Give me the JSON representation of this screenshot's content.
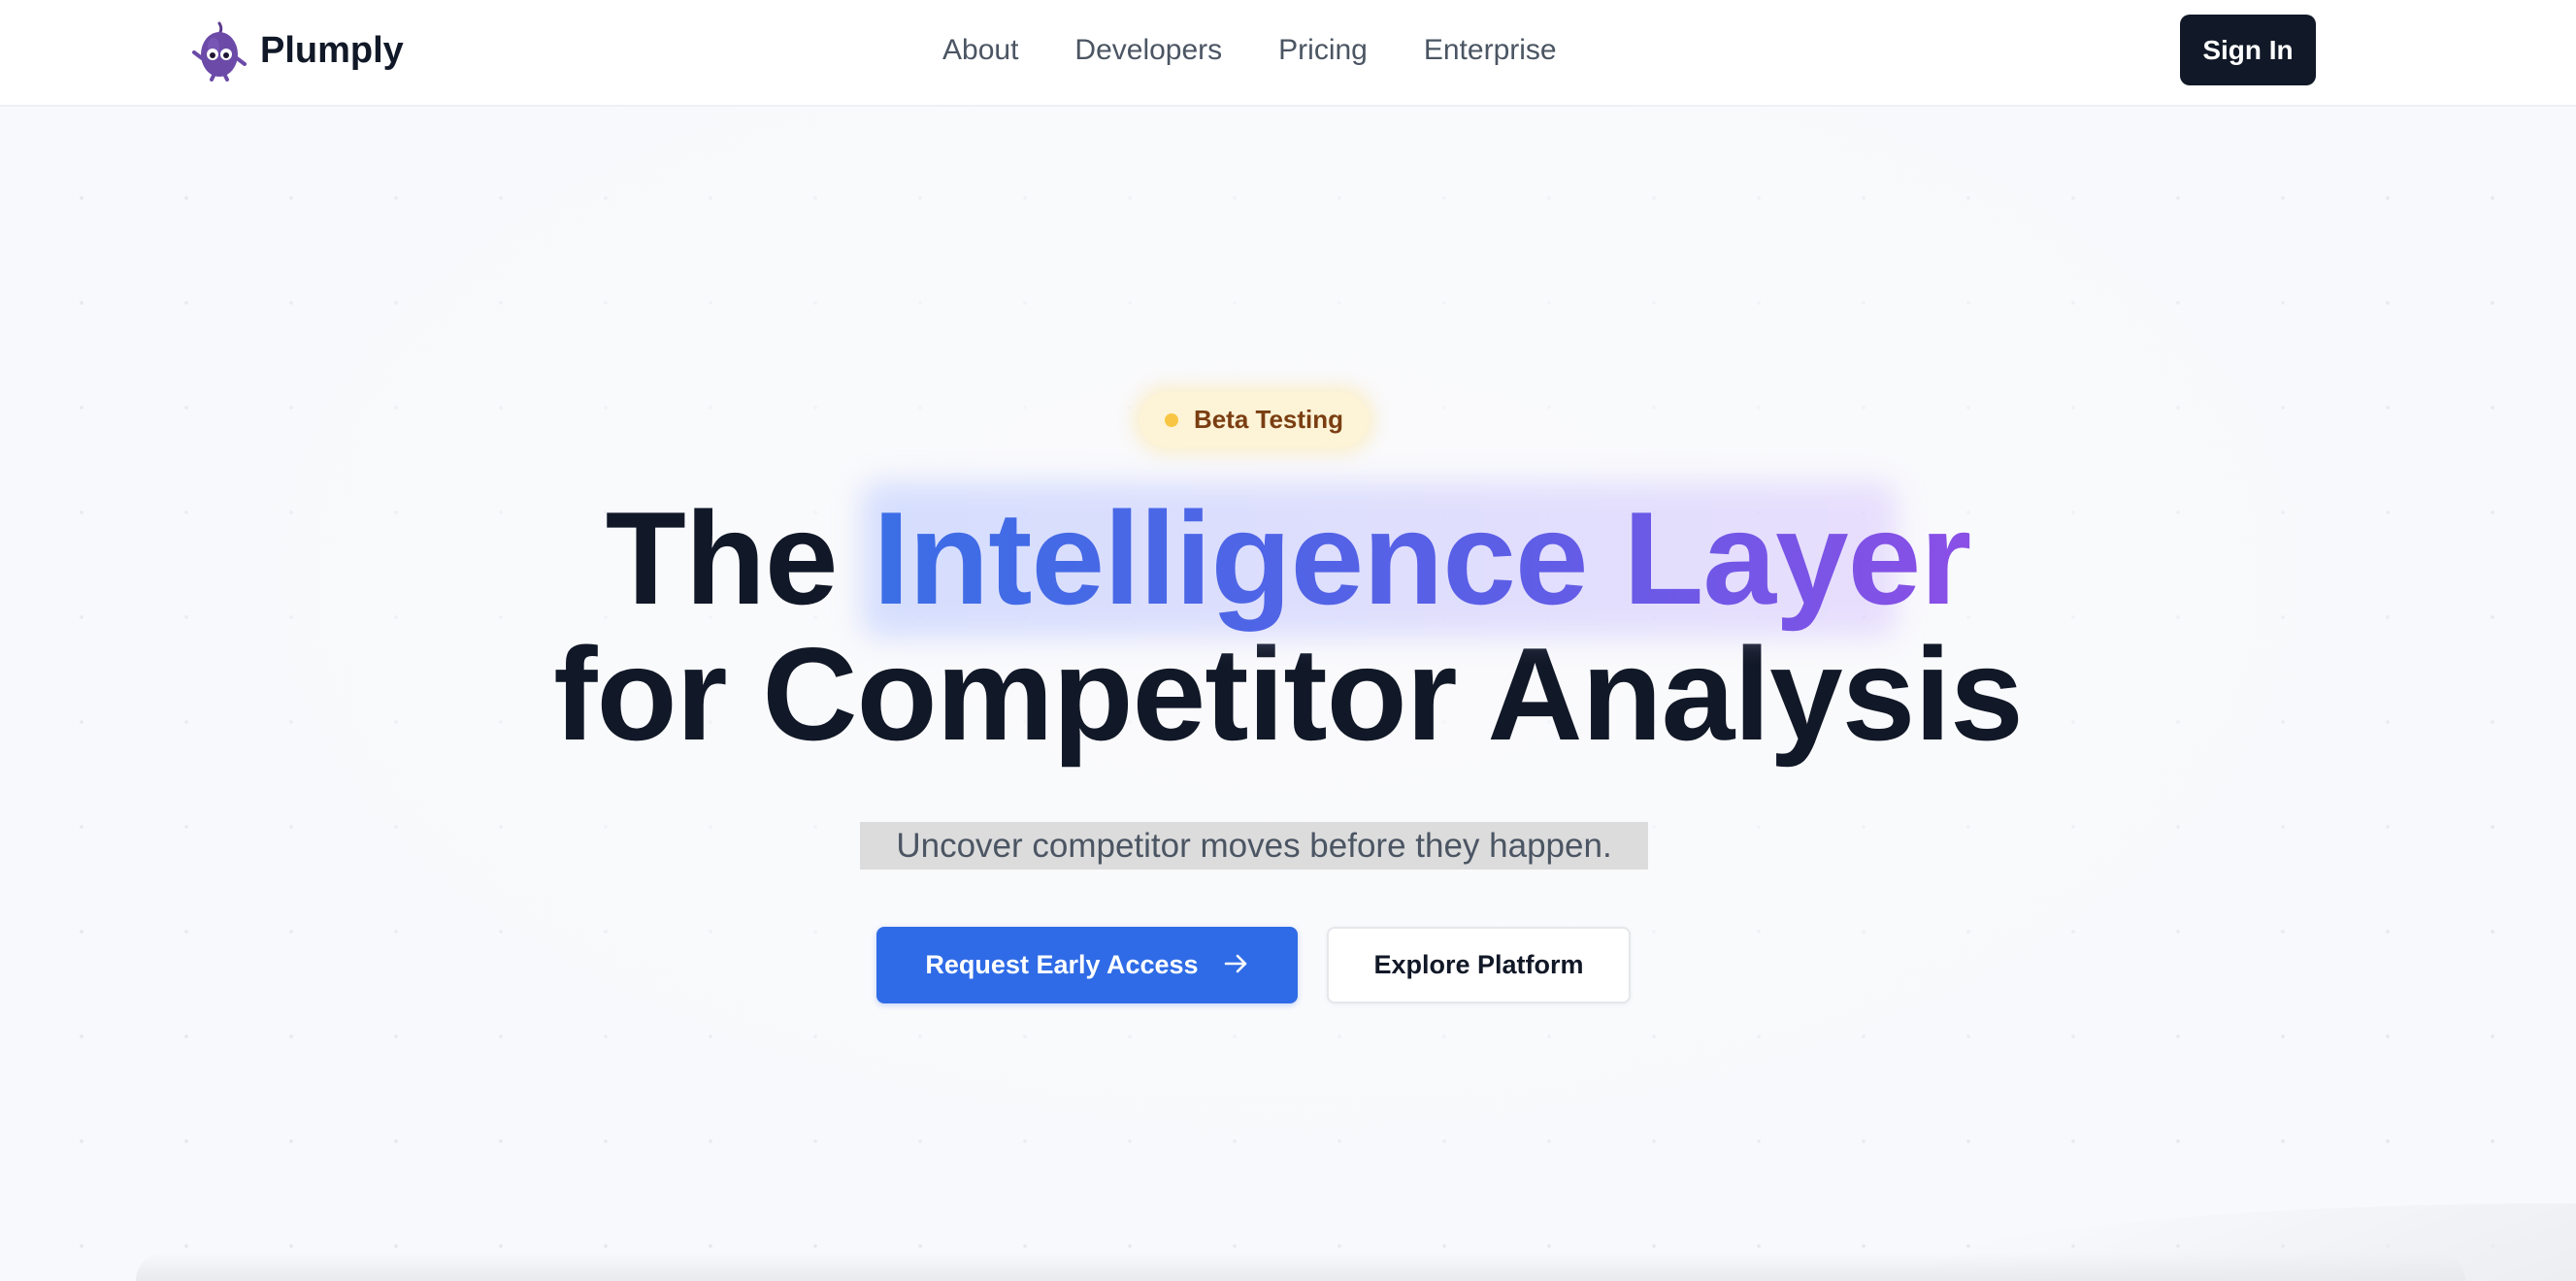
{
  "brand": {
    "name": "Plumply",
    "logo_icon": "plum-mascot-icon"
  },
  "nav": {
    "items": [
      "About",
      "Developers",
      "Pricing",
      "Enterprise"
    ]
  },
  "header": {
    "signin_label": "Sign In"
  },
  "hero": {
    "badge": "Beta Testing",
    "title_part1": "The ",
    "title_highlight": "Intelligence Layer",
    "title_line2": "for Competitor Analysis",
    "subtitle": "Uncover competitor moves before they happen.",
    "primary_cta": "Request Early Access",
    "primary_cta_icon": "arrow-right-icon",
    "secondary_cta": "Explore Platform"
  },
  "colors": {
    "accent": "#2f6be6",
    "dark": "#111827",
    "gradient_start": "#3b6ee6",
    "gradient_end": "#8a4fe6",
    "badge_bg": "#fdf3d6",
    "badge_dot": "#f8c644"
  }
}
